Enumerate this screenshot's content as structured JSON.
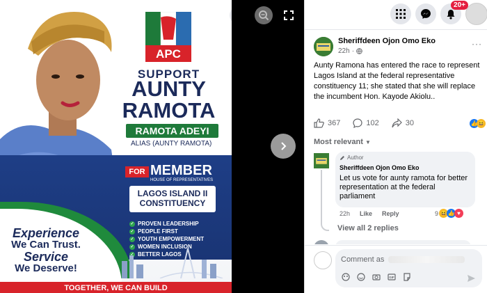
{
  "poster": {
    "party": "APC",
    "support": "SUPPORT",
    "line1": "AUNTY",
    "line2": "RAMOTA",
    "name_tag": "RAMOTA ADEYI",
    "alias": "ALIAS (AUNTY RAMOTA)",
    "for_label": "FOR",
    "member": "MEMBER",
    "house": "HOUSE OF REPRESENTATIVES",
    "constituency_l1": "LAGOS ISLAND II",
    "constituency_l2": "CONSTITUENCY",
    "bullets": [
      "PROVEN LEADERSHIP",
      "PEOPLE FIRST",
      "YOUTH EMPOWERMENT",
      "WOMEN INCLUSION",
      "BETTER LAGOS"
    ],
    "slogan_1": "Experience",
    "slogan_2": "We Can Trust.",
    "slogan_3": "Service",
    "slogan_4": "We Deserve!",
    "bottom": "TOGETHER, WE CAN BUILD"
  },
  "viewer": {
    "icons": [
      "zoom-in-icon",
      "zoom-out-icon",
      "fullscreen-icon",
      "chevron-right-icon"
    ]
  },
  "topbar": {
    "notification_count": "20+"
  },
  "post": {
    "author": "Sheriffdeen Ojon Omo Eko",
    "time": "22h",
    "text": "Aunty Ramona has entered the race to represent Lagos Island at the federal representative constituency 11; she stated that she will replace the incumbent Hon. Kayode Akiolu..",
    "likes": "367",
    "comments": "102",
    "shares": "30"
  },
  "comments_section": {
    "sort_label": "Most relevant",
    "first_comment": {
      "tag": "Author",
      "name": "Sheriffdeen Ojon Omo Eko",
      "text": "Let us vote for aunty ramota for better representation at the federal parliament",
      "time": "22h",
      "like": "Like",
      "reply": "Reply",
      "reactions": "9"
    },
    "view_replies": "View all 2 replies"
  },
  "composer": {
    "placeholder": "Comment as"
  },
  "colors": {
    "apc_green": "#1e7a3a",
    "apc_red": "#d8232a",
    "navy": "#1b2a5a",
    "fb_blue": "#1877f2"
  }
}
